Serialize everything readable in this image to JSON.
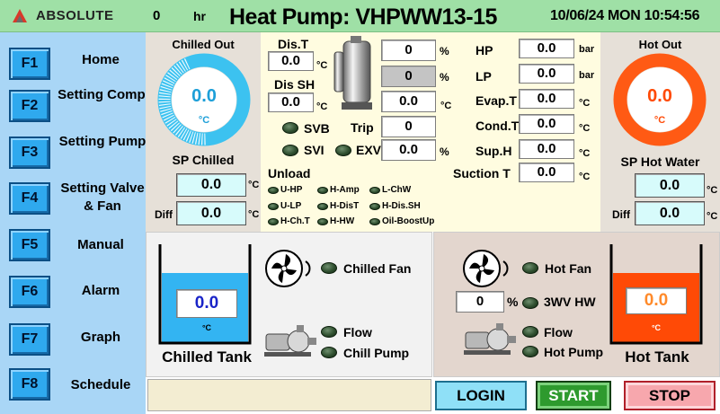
{
  "header": {
    "brand": "ABSOLUTE",
    "run_hours": "0",
    "run_hours_unit": "hr",
    "title": "Heat Pump: VHPWW13-15",
    "datetime": "10/06/24  MON 10:54:56",
    "colors": {
      "bar": "#9fe0a6"
    }
  },
  "sidebar": {
    "items": [
      {
        "key": "F1",
        "label": "Home"
      },
      {
        "key": "F2",
        "label": "Setting Comp."
      },
      {
        "key": "F3",
        "label": "Setting Pump"
      },
      {
        "key": "F4",
        "label": "Setting Valve & Fan"
      },
      {
        "key": "F5",
        "label": "Manual"
      },
      {
        "key": "F6",
        "label": "Alarm"
      },
      {
        "key": "F7",
        "label": "Graph"
      },
      {
        "key": "F8",
        "label": "Schedule"
      }
    ]
  },
  "chilled": {
    "title": "Chilled Out",
    "value": "0.0",
    "unit": "°C",
    "sp_title": "SP Chilled",
    "sp_value": "0.0",
    "sp_unit": "°C",
    "diff_label": "Diff",
    "diff_value": "0.0",
    "diff_unit": "°C",
    "color": "#3cc2f0"
  },
  "hot": {
    "title": "Hot Out",
    "value": "0.0",
    "unit": "°C",
    "sp_title": "SP Hot Water",
    "sp_value": "0.0",
    "sp_unit": "°C",
    "diff_label": "Diff",
    "diff_value": "0.0",
    "diff_unit": "°C",
    "color": "#ff5a14"
  },
  "compressor": {
    "dis_t_label": "Dis.T",
    "dis_t_value": "0.0",
    "dis_t_unit": "°C",
    "dis_sh_label": "Dis SH",
    "dis_sh_value": "0.0",
    "dis_sh_unit": "°C",
    "pct1_value": "0",
    "pct1_unit": "%",
    "pct2_value": "0",
    "pct2_unit": "%",
    "temp_value": "0.0",
    "temp_unit": "°C",
    "svb_label": "SVB",
    "svi_label": "SVI",
    "trip_label": "Trip",
    "trip_value": "0",
    "exv_label": "EXV",
    "exv_value": "0.0",
    "exv_unit": "%"
  },
  "readings": [
    {
      "label": "HP",
      "value": "0.0",
      "unit": "bar"
    },
    {
      "label": "LP",
      "value": "0.0",
      "unit": "bar"
    },
    {
      "label": "Evap.T",
      "value": "0.0",
      "unit": "°C"
    },
    {
      "label": "Cond.T",
      "value": "0.0",
      "unit": "°C"
    },
    {
      "label": "Sup.H",
      "value": "0.0",
      "unit": "°C"
    },
    {
      "label": "Suction T",
      "value": "0.0",
      "unit": "°C"
    }
  ],
  "unload": {
    "title": "Unload",
    "items": [
      "U-HP",
      "H-Amp",
      "L-ChW",
      "U-LP",
      "H-DisT",
      "H-Dis.SH",
      "H-Ch.T",
      "H-HW",
      "Oil-BoostUp"
    ]
  },
  "chilled_tank": {
    "label": "Chilled Tank",
    "value": "0.0",
    "unit": "°C",
    "fan_label": "Chilled Fan",
    "flow_label": "Flow",
    "pump_label": "Chill Pump",
    "color": "#33b4f2"
  },
  "hot_tank": {
    "label": "Hot Tank",
    "value": "0.0",
    "unit": "°C",
    "fan_label": "Hot Fan",
    "valve_value": "0",
    "valve_unit": "%",
    "valve_label": "3WV HW",
    "flow_label": "Flow",
    "pump_label": "Hot Pump",
    "color": "#ff4a06"
  },
  "buttons": {
    "login": "LOGIN",
    "start": "START",
    "stop": "STOP"
  }
}
